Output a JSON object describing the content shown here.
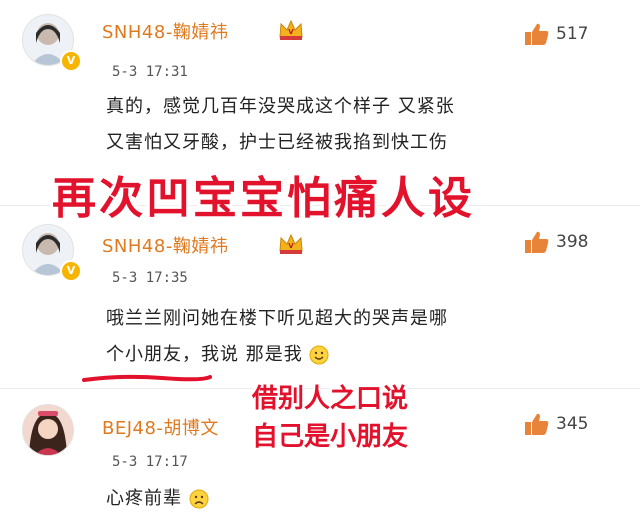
{
  "comments": [
    {
      "username": "SNH48-鞠婧祎",
      "time": "5-3 17:31",
      "likes": "517",
      "text_lines": [
        "真的，感觉几百年没哭成这个样子 又紧张",
        "又害怕又牙酸，护士已经被我掐到快工伤"
      ]
    },
    {
      "username": "SNH48-鞠婧祎",
      "time": "5-3 17:35",
      "likes": "398",
      "text_lines": [
        "哦兰兰刚问她在楼下听见超大的哭声是哪",
        "个小朋友，我说 那是我"
      ]
    },
    {
      "username": "BEJ48-胡博文",
      "time": "5-3 17:17",
      "likes": "345",
      "text_lines": [
        "心疼前辈"
      ]
    }
  ],
  "overlay": {
    "banner": "再次凹宝宝怕痛人设",
    "note_line1": "借别人之口说",
    "note_line2": "自己是小朋友"
  },
  "icons": {
    "like": "thumbs-up-icon",
    "verified": "verified-badge-icon",
    "vip": "crown-icon",
    "emoji_smile": "smile-emoji-icon",
    "emoji_sad": "sad-emoji-icon"
  },
  "colors": {
    "username": "#e07a1f",
    "overlay_red": "#e2122c",
    "like_icon": "#e8833a",
    "badge": "#f7b500"
  }
}
